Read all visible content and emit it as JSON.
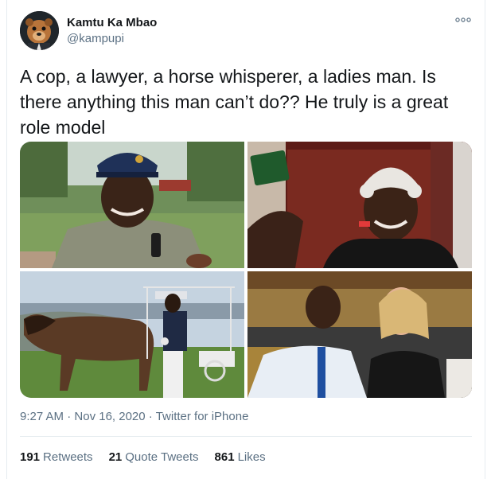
{
  "author": {
    "display_name": "Kamtu Ka Mbao",
    "handle": "@kampupi"
  },
  "tweet": {
    "text": "A cop, a lawyer, a horse whisperer, a ladies man. Is there anything this man can’t do?? He truly is a great role model"
  },
  "meta": {
    "time": "9:27 AM",
    "separator": " · ",
    "date": "Nov 16, 2020",
    "source": "Twitter for iPhone"
  },
  "stats": {
    "retweets_count": "191",
    "retweets_label": "Retweets",
    "quotes_count": "21",
    "quotes_label": "Quote Tweets",
    "likes_count": "861",
    "likes_label": "Likes"
  },
  "icons": {
    "more": "more-options-icon"
  },
  "colors": {
    "text_primary": "#14171a",
    "text_secondary": "#5b7083",
    "divider": "#e6ecf0"
  }
}
